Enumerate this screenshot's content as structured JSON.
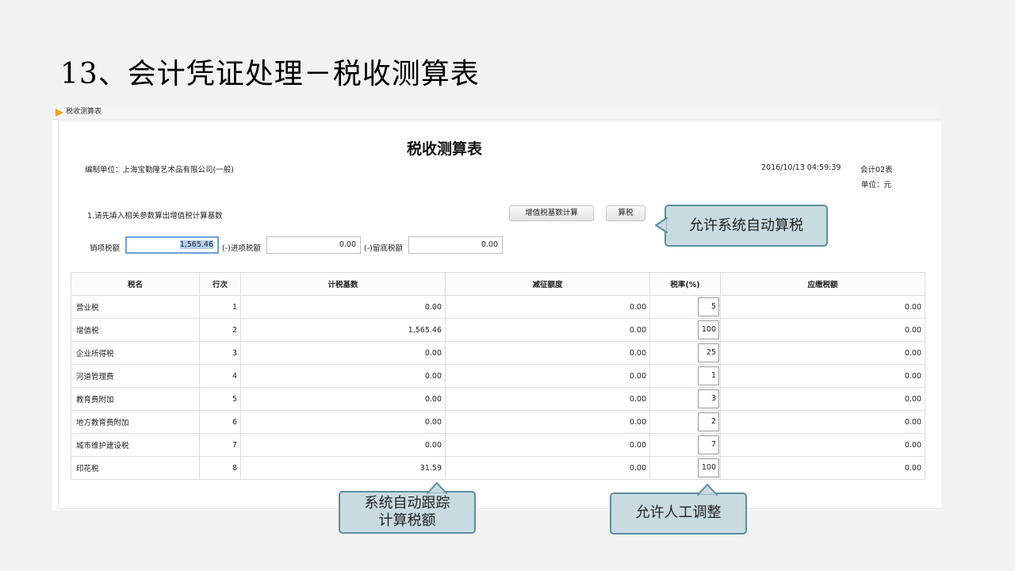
{
  "slide": {
    "title": "13、会计凭证处理－税收测算表"
  },
  "tab": {
    "label": "税收测算表"
  },
  "report": {
    "title": "税收测算表",
    "org_label": "编制单位：上海宝勤隆艺术品有限公司(一般)",
    "datetime": "2016/10/13 04:59:39",
    "form_no": "会计02表",
    "unit": "单位：元"
  },
  "step": {
    "instruction": "1.请先填入相关参数算出增值税计算基数"
  },
  "buttons": {
    "vat_base": "增值税基数计算",
    "calc_tax": "算税"
  },
  "params": {
    "output_label": "销项税额",
    "output_value": "1,565.46",
    "input_label": "(-)进项税额",
    "input_value": "0.00",
    "retained_label": "(-)留底税额",
    "retained_value": "0.00"
  },
  "table": {
    "headers": [
      "税名",
      "行次",
      "计税基数",
      "减征额度",
      "税率(%)",
      "应缴税额"
    ],
    "rows": [
      {
        "name": "营业税",
        "line": "1",
        "base": "0.00",
        "reduction": "0.00",
        "rate": "5",
        "payable": "0.00"
      },
      {
        "name": "增值税",
        "line": "2",
        "base": "1,565.46",
        "reduction": "0.00",
        "rate": "100",
        "payable": "0.00"
      },
      {
        "name": "企业所得税",
        "line": "3",
        "base": "0.00",
        "reduction": "0.00",
        "rate": "25",
        "payable": "0.00"
      },
      {
        "name": "河道管理费",
        "line": "4",
        "base": "0.00",
        "reduction": "0.00",
        "rate": "1",
        "payable": "0.00"
      },
      {
        "name": "教育费附加",
        "line": "5",
        "base": "0.00",
        "reduction": "0.00",
        "rate": "3",
        "payable": "0.00"
      },
      {
        "name": "地方教育费附加",
        "line": "6",
        "base": "0.00",
        "reduction": "0.00",
        "rate": "2",
        "payable": "0.00"
      },
      {
        "name": "城市维护建设税",
        "line": "7",
        "base": "0.00",
        "reduction": "0.00",
        "rate": "7",
        "payable": "0.00"
      },
      {
        "name": "印花税",
        "line": "8",
        "base": "31.59",
        "reduction": "0.00",
        "rate": "100",
        "payable": "0.00"
      }
    ]
  },
  "callouts": {
    "auto_tax": "允许系统自动算税",
    "auto_track_line1": "系统自动跟踪",
    "auto_track_line2": "计算税额",
    "manual_adjust": "允许人工调整"
  },
  "colors": {
    "callout_fill": "#c9dbe1",
    "callout_border": "#5a8ea0",
    "tab_arrow": "#f0a020",
    "focus_border": "#6ea0dc"
  }
}
